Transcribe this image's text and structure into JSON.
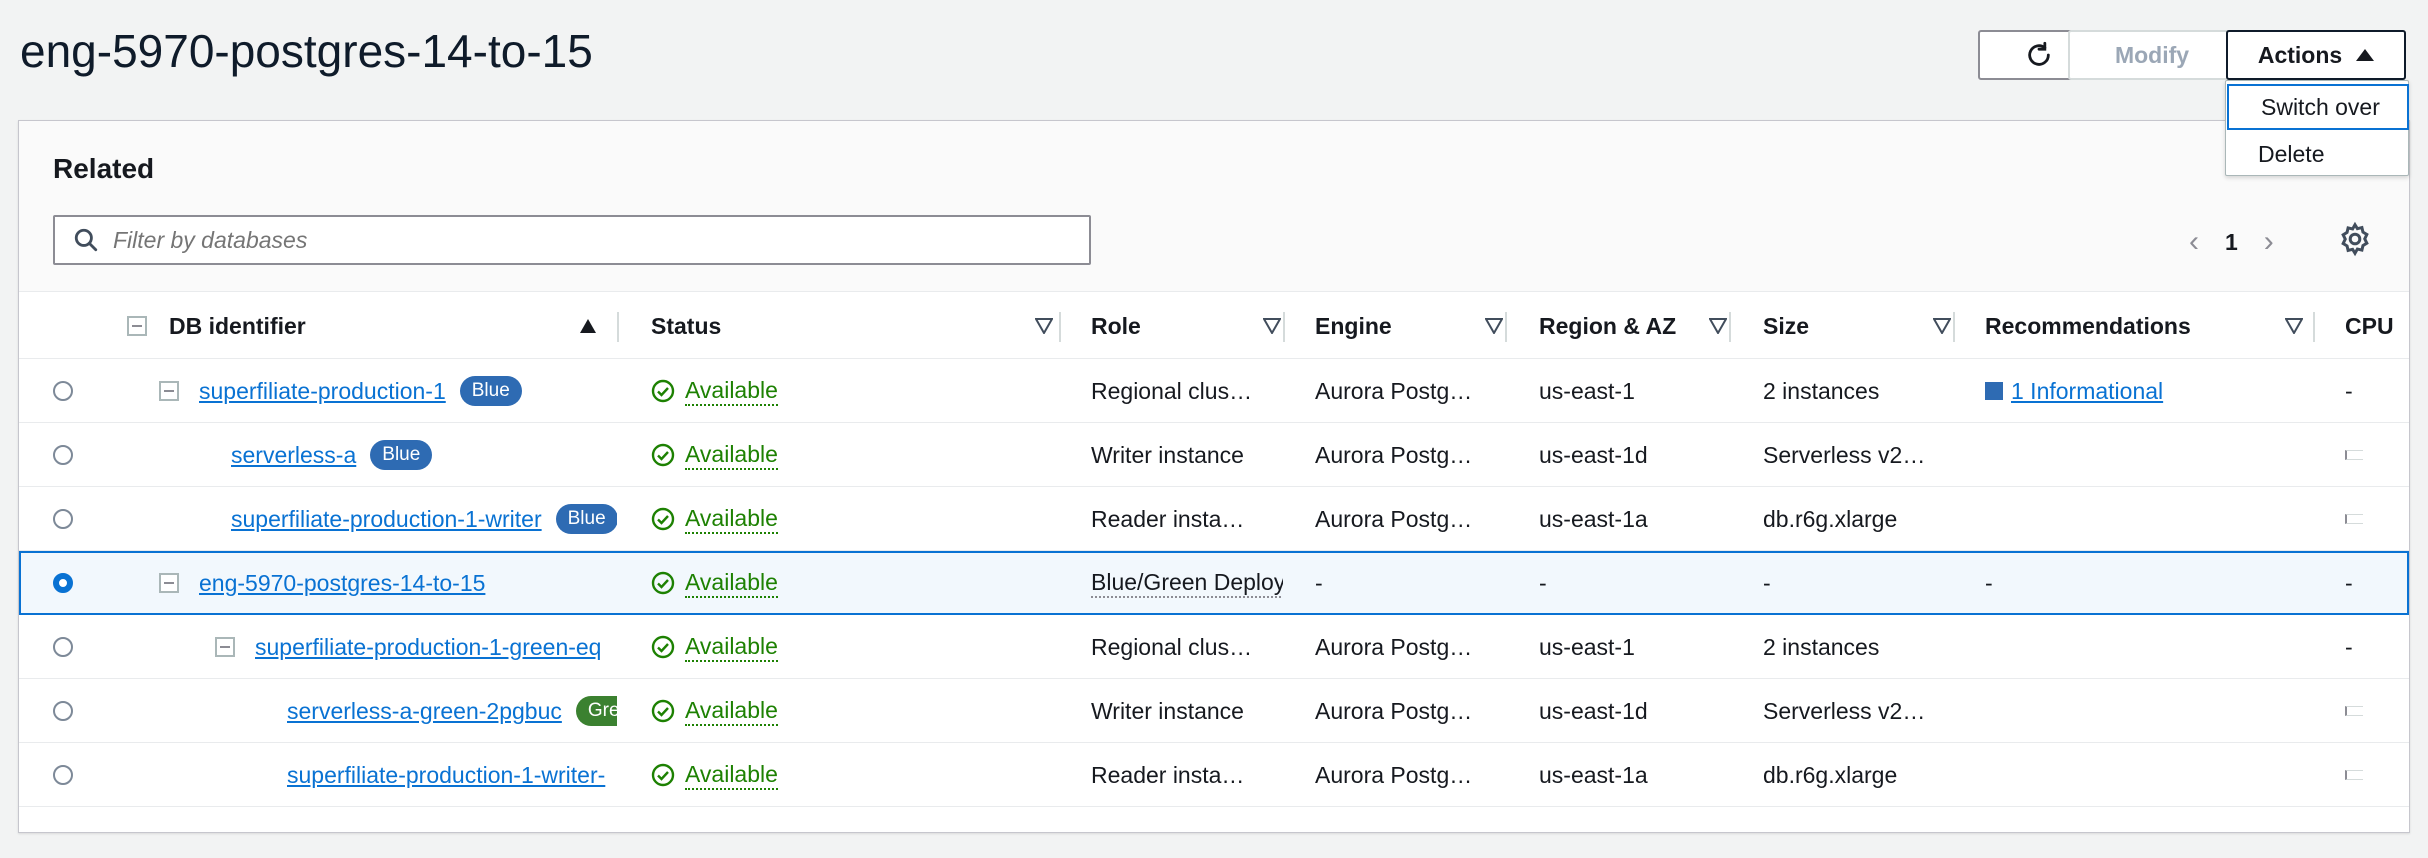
{
  "page": {
    "title": "eng-5970-postgres-14-to-15"
  },
  "toolbar": {
    "modify_label": "Modify",
    "actions_label": "Actions"
  },
  "actions_menu": {
    "items": [
      "Switch over",
      "Delete"
    ]
  },
  "related": {
    "heading": "Related",
    "filter_placeholder": "Filter by databases",
    "pagination": {
      "current_page": "1"
    }
  },
  "table": {
    "columns": [
      "DB identifier",
      "Status",
      "Role",
      "Engine",
      "Region & AZ",
      "Size",
      "Recommendations",
      "CPU"
    ],
    "rows": [
      {
        "id": "superfiliate-production-1",
        "badge": "Blue",
        "status": "Available",
        "role": "Regional clus…",
        "engine": "Aurora Postg…",
        "region": "us-east-1",
        "size": "2 instances",
        "recommendation": "1 Informational",
        "cpu": "-"
      },
      {
        "id": "serverless-a",
        "badge": "Blue",
        "status": "Available",
        "role": "Writer instance",
        "engine": "Aurora Postg…",
        "region": "us-east-1d",
        "size": "Serverless v2…",
        "recommendation": "",
        "cpu": ""
      },
      {
        "id": "superfiliate-production-1-writer",
        "badge": "Blue",
        "status": "Available",
        "role": "Reader insta…",
        "engine": "Aurora Postg…",
        "region": "us-east-1a",
        "size": "db.r6g.xlarge",
        "recommendation": "",
        "cpu": ""
      },
      {
        "id": "eng-5970-postgres-14-to-15",
        "badge": "",
        "status": "Available",
        "role": "Blue/Green Deploy",
        "engine": "-",
        "region": "-",
        "size": "-",
        "recommendation": "-",
        "cpu": "-"
      },
      {
        "id": "superfiliate-production-1-green-eq",
        "badge": "",
        "status": "Available",
        "role": "Regional clus…",
        "engine": "Aurora Postg…",
        "region": "us-east-1",
        "size": "2 instances",
        "recommendation": "",
        "cpu": "-"
      },
      {
        "id": "serverless-a-green-2pgbuc",
        "badge": "Gre",
        "status": "Available",
        "role": "Writer instance",
        "engine": "Aurora Postg…",
        "region": "us-east-1d",
        "size": "Serverless v2…",
        "recommendation": "",
        "cpu": ""
      },
      {
        "id": "superfiliate-production-1-writer-",
        "badge": "",
        "status": "Available",
        "role": "Reader insta…",
        "engine": "Aurora Postg…",
        "region": "us-east-1a",
        "size": "db.r6g.xlarge",
        "recommendation": "",
        "cpu": ""
      }
    ]
  },
  "colors": {
    "link": "#0972d3",
    "available": "#1d8102",
    "badge_blue": "#2e6bb3",
    "badge_green": "#3b8130",
    "selected_row_border": "#0972d3"
  },
  "icons": {
    "refresh": "refresh-icon",
    "search": "search-icon",
    "settings": "gear-icon",
    "status": "check-circle-icon"
  }
}
